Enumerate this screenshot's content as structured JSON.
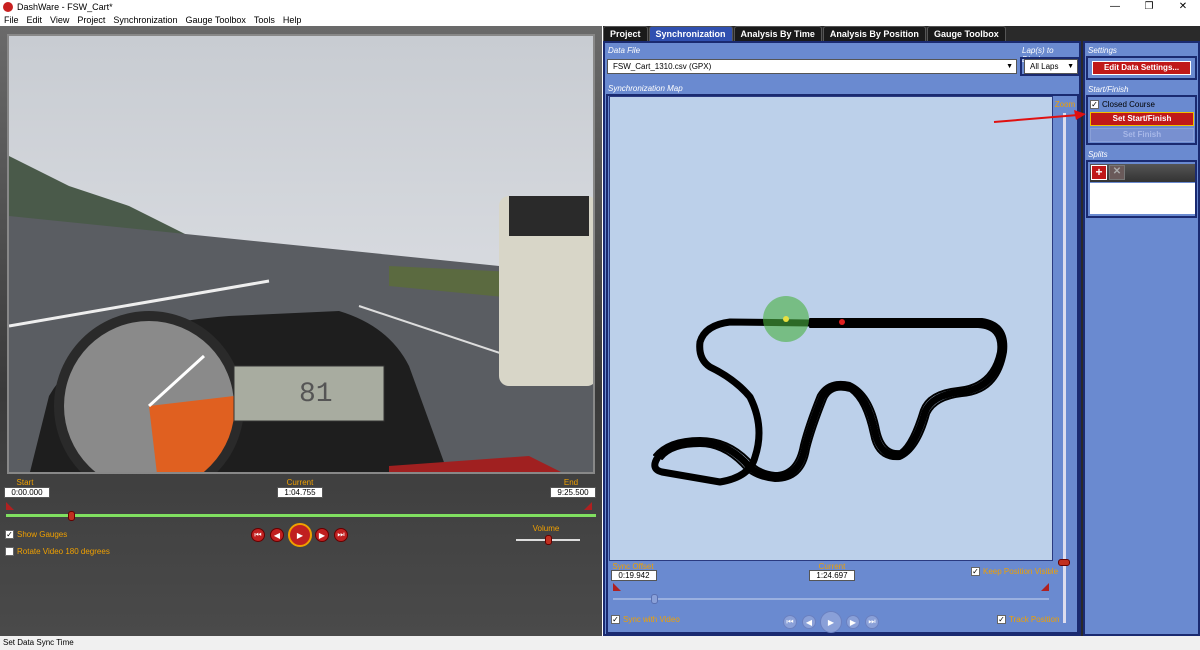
{
  "window": {
    "title": "DashWare - FSW_Cart*",
    "minimize": "—",
    "restore": "❐",
    "close": "✕"
  },
  "menu": [
    "File",
    "Edit",
    "View",
    "Project",
    "Synchronization",
    "Gauge Toolbox",
    "Tools",
    "Help"
  ],
  "video_panel": {
    "start_label": "Start",
    "start_value": "0:00.000",
    "current_label": "Current",
    "current_value": "1:04.755",
    "end_label": "End",
    "end_value": "9:25.500",
    "position_fraction": 0.11,
    "volume_label": "Volume",
    "volume_fraction": 0.5,
    "show_gauges_label": "Show Gauges",
    "show_gauges_checked": true,
    "rotate_label": "Rotate Video 180 degrees",
    "rotate_checked": false
  },
  "tabs": [
    {
      "label": "Project",
      "active": false
    },
    {
      "label": "Synchronization",
      "active": true
    },
    {
      "label": "Analysis By Time",
      "active": false
    },
    {
      "label": "Analysis By Position",
      "active": false
    },
    {
      "label": "Gauge Toolbox",
      "active": false
    }
  ],
  "sync": {
    "data_file_label": "Data File",
    "data_file_value": "FSW_Cart_1310.csv (GPX)",
    "laps_label": "Lap(s) to Display",
    "laps_value": "All Laps",
    "map_label": "Synchronization Map",
    "zoom_label": "Zoom",
    "offset_label": "Sync Offset",
    "offset_value": "0:19.942",
    "current_label": "Current",
    "current_value": "1:24.697",
    "keep_visible_label": "Keep Position Visible",
    "keep_visible_checked": true,
    "sync_video_label": "Sync with Video",
    "sync_video_checked": true,
    "track_position_label": "Track Position",
    "track_position_checked": true
  },
  "side": {
    "settings_label": "Settings",
    "edit_data_settings": "Edit Data Settings...",
    "start_finish_label": "Start/Finish",
    "closed_course_label": "Closed Course",
    "closed_course_checked": true,
    "set_start_finish": "Set Start/Finish",
    "set_finish": "Set Finish",
    "splits_label": "Splits"
  },
  "status": "Set Data Sync Time",
  "colors": {
    "accent_red": "#c01818",
    "label_orange": "#f0a000",
    "panel_blue": "#6a8ad0"
  }
}
